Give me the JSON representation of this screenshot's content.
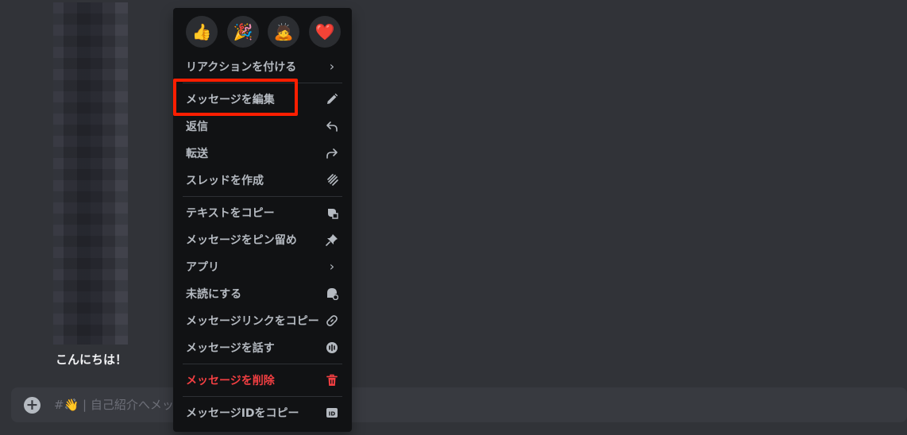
{
  "message": {
    "text": "こんにちは！"
  },
  "composer": {
    "placeholder": "#👋 | 自己紹介へメッセージを送信"
  },
  "reactions": [
    {
      "emoji": "👍",
      "icon": "thumbs-up-icon"
    },
    {
      "emoji": "🎉",
      "icon": "party-popper-icon"
    },
    {
      "emoji": "🙇",
      "icon": "bowing-person-icon"
    },
    {
      "emoji": "❤️",
      "icon": "heart-icon"
    }
  ],
  "menu": {
    "add_reaction": "リアクションを付ける",
    "edit_message": "メッセージを編集",
    "reply": "返信",
    "forward": "転送",
    "create_thread": "スレッドを作成",
    "copy_text": "テキストをコピー",
    "pin_message": "メッセージをピン留め",
    "apps": "アプリ",
    "mark_unread": "未読にする",
    "copy_link": "メッセージリンクをコピー",
    "speak_message": "メッセージを話す",
    "delete_message": "メッセージを削除",
    "copy_id": "メッセージIDをコピー"
  },
  "colors": {
    "menu_bg": "#111214",
    "danger": "#f23f42",
    "highlight": "#ff1e00"
  }
}
